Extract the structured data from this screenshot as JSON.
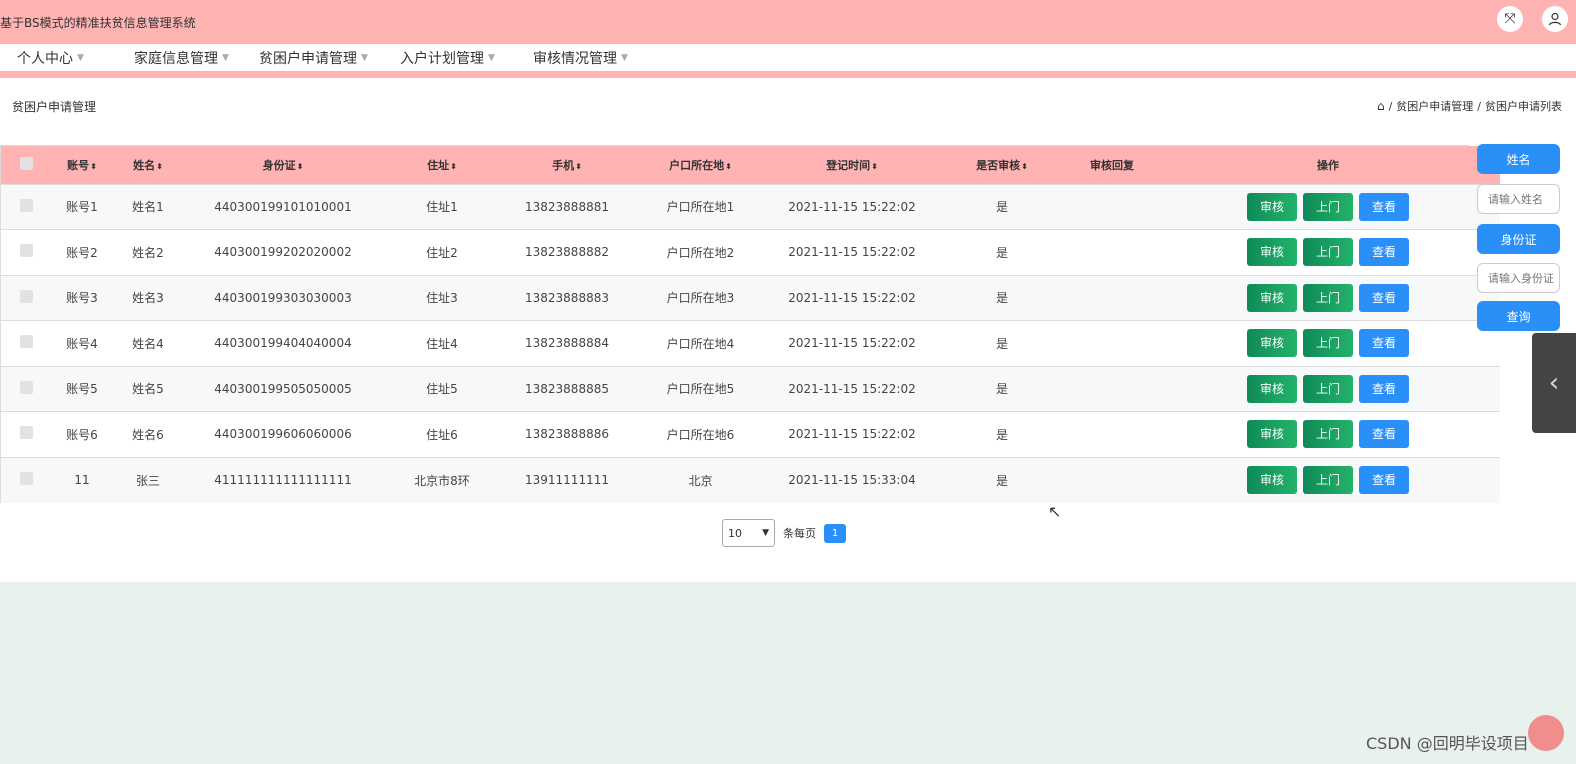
{
  "app": {
    "title": "基于BS模式的精准扶贫信息管理系统"
  },
  "nav": [
    {
      "label": "个人中心"
    },
    {
      "label": "家庭信息管理"
    },
    {
      "label": "贫困户申请管理"
    },
    {
      "label": "入户计划管理"
    },
    {
      "label": "审核情况管理"
    }
  ],
  "page": {
    "title": "贫困户申请管理",
    "breadcrumb": [
      "贫困户申请管理",
      "贫困户申请列表"
    ]
  },
  "table": {
    "headers": [
      "账号",
      "姓名",
      "身份证",
      "住址",
      "手机",
      "户口所在地",
      "登记时间",
      "是否审核",
      "审核回复",
      "操作"
    ],
    "rows": [
      {
        "account": "账号1",
        "name": "姓名1",
        "id": "440300199101010001",
        "address": "住址1",
        "phone": "13823888881",
        "hukou": "户口所在地1",
        "time": "2021-11-15 15:22:02",
        "audited": "是",
        "reply": ""
      },
      {
        "account": "账号2",
        "name": "姓名2",
        "id": "440300199202020002",
        "address": "住址2",
        "phone": "13823888882",
        "hukou": "户口所在地2",
        "time": "2021-11-15 15:22:02",
        "audited": "是",
        "reply": ""
      },
      {
        "account": "账号3",
        "name": "姓名3",
        "id": "440300199303030003",
        "address": "住址3",
        "phone": "13823888883",
        "hukou": "户口所在地3",
        "time": "2021-11-15 15:22:02",
        "audited": "是",
        "reply": ""
      },
      {
        "account": "账号4",
        "name": "姓名4",
        "id": "440300199404040004",
        "address": "住址4",
        "phone": "13823888884",
        "hukou": "户口所在地4",
        "time": "2021-11-15 15:22:02",
        "audited": "是",
        "reply": ""
      },
      {
        "account": "账号5",
        "name": "姓名5",
        "id": "440300199505050005",
        "address": "住址5",
        "phone": "13823888885",
        "hukou": "户口所在地5",
        "time": "2021-11-15 15:22:02",
        "audited": "是",
        "reply": ""
      },
      {
        "account": "账号6",
        "name": "姓名6",
        "id": "440300199606060006",
        "address": "住址6",
        "phone": "13823888886",
        "hukou": "户口所在地6",
        "time": "2021-11-15 15:22:02",
        "audited": "是",
        "reply": ""
      },
      {
        "account": "11",
        "name": "张三",
        "id": "411111111111111111",
        "address": "北京市8环",
        "phone": "13911111111",
        "hukou": "北京",
        "time": "2021-11-15 15:33:04",
        "audited": "是",
        "reply": ""
      }
    ],
    "actions": {
      "audit": "审核",
      "visit": "上门",
      "view": "查看"
    }
  },
  "pagination": {
    "page_size": "10",
    "per_page_label": "条每页",
    "current_page": "1"
  },
  "search": {
    "name_label": "姓名",
    "name_placeholder": "请输入姓名",
    "id_label": "身份证",
    "id_placeholder": "请输入身份证",
    "query_button": "查询"
  },
  "watermark": "CSDN @回明毕设项目",
  "colors": {
    "header": "#ffb3b3",
    "primary": "#2a8ff7",
    "green": "#14955d"
  }
}
